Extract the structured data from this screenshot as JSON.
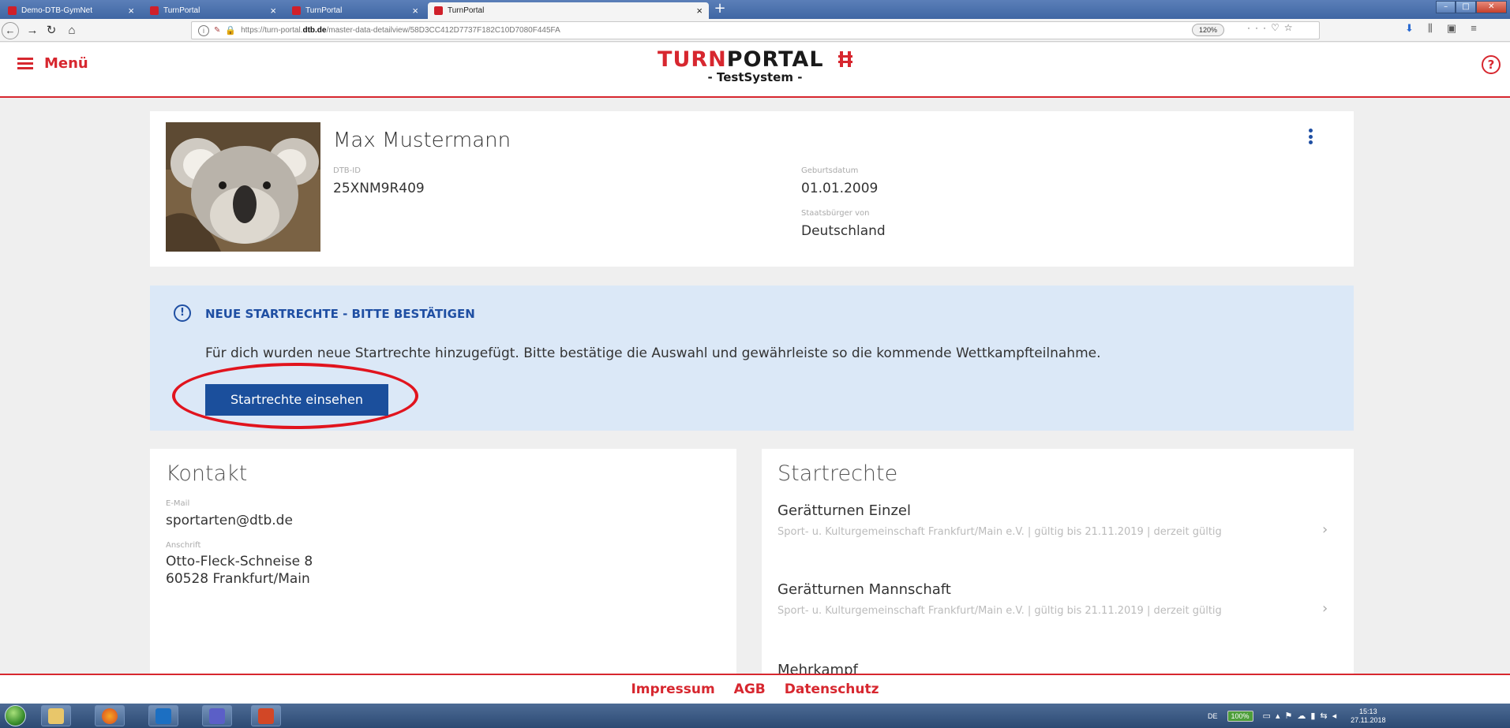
{
  "browser": {
    "tabs": [
      {
        "title": "Demo-DTB-GymNet",
        "active": false
      },
      {
        "title": "TurnPortal",
        "active": false
      },
      {
        "title": "TurnPortal",
        "active": false
      },
      {
        "title": "TurnPortal",
        "active": true
      }
    ],
    "new_tab": "+",
    "url_prefix": "https://turn-portal.",
    "url_domain": "dtb.de",
    "url_path": "/master-data-detailview/58D3CC412D7737F182C10D7080F445FA",
    "zoom": "120%",
    "url_actions": "···",
    "colors": {
      "tabstrip": "#3f66a3",
      "toolbar": "#f4f4f4"
    }
  },
  "header": {
    "menu_label": "Menü",
    "logo_red": "TURN",
    "logo_dark": "PORTAL",
    "logo_sub": "- TestSystem -",
    "help_icon": "question-circle-icon",
    "accent": "#d7272f"
  },
  "profile": {
    "name": "Max Mustermann",
    "dtb_id_label": "DTB-ID",
    "dtb_id": "25XNM9R409",
    "birthdate_label": "Geburtsdatum",
    "birthdate": "01.01.2009",
    "citizenship_label": "Staatsbürger von",
    "citizenship": "Deutschland"
  },
  "notice": {
    "title": "NEUE STARTRECHTE - BITTE BESTÄTIGEN",
    "text": "Für dich wurden neue Startrechte hinzugefügt. Bitte bestätige die Auswahl und gewährleiste so die kommende Wettkampfteilnahme.",
    "button": "Startrechte einsehen",
    "bg": "#dbe8f7",
    "button_color": "#1b4f9c"
  },
  "contact": {
    "heading": "Kontakt",
    "email_label": "E-Mail",
    "email": "sportarten@dtb.de",
    "address_label": "Anschrift",
    "address": "Otto-Fleck-Schneise 8\n60528 Frankfurt/Main"
  },
  "startrechte": {
    "heading": "Startrechte",
    "items": [
      {
        "title": "Gerätturnen Einzel",
        "desc": "Sport- u. Kulturgemeinschaft Frankfurt/Main e.V. | gültig bis 21.11.2019 | derzeit gültig"
      },
      {
        "title": "Gerätturnen Mannschaft",
        "desc": "Sport- u. Kulturgemeinschaft Frankfurt/Main e.V. | gültig bis 21.11.2019 | derzeit gültig"
      },
      {
        "title": "Mehrkampf",
        "desc": ""
      }
    ]
  },
  "footer": {
    "links": [
      "Impressum",
      "AGB",
      "Datenschutz"
    ]
  },
  "taskbar": {
    "lang": "DE",
    "battery": "100%",
    "time": "15:13",
    "date": "27.11.2018"
  }
}
